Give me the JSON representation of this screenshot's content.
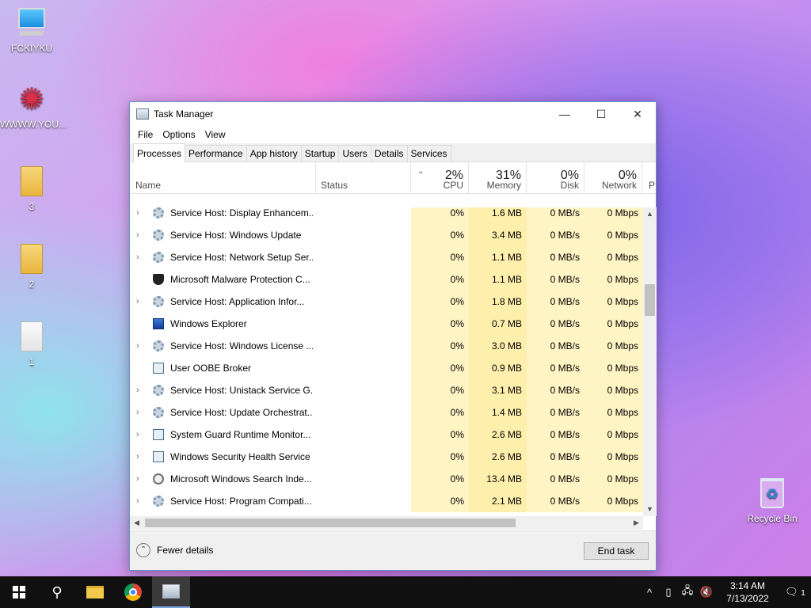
{
  "desktop": {
    "icons": [
      {
        "label": "FCKIYKU",
        "icon": "computer-icon"
      },
      {
        "label": "WWWW.YOU...",
        "icon": "shortcut-icon"
      },
      {
        "label": "3",
        "icon": "folder-icon"
      },
      {
        "label": "2",
        "icon": "folder-icon"
      },
      {
        "label": "1",
        "icon": "document-folder-icon"
      },
      {
        "label": "Recycle Bin",
        "icon": "recycle-bin-icon"
      }
    ]
  },
  "window": {
    "title": "Task Manager",
    "controls": {
      "minimize": "—",
      "maximize": "☐",
      "close": "✕"
    },
    "menu": [
      "File",
      "Options",
      "View"
    ],
    "tabs": [
      "Processes",
      "Performance",
      "App history",
      "Startup",
      "Users",
      "Details",
      "Services"
    ],
    "active_tab": "Processes",
    "columns": {
      "name": "Name",
      "status": "Status",
      "cpu": {
        "pct": "2%",
        "label": "CPU"
      },
      "memory": {
        "pct": "31%",
        "label": "Memory"
      },
      "disk": {
        "pct": "0%",
        "label": "Disk"
      },
      "network": {
        "pct": "0%",
        "label": "Network"
      },
      "power": "P"
    },
    "processes": [
      {
        "name": "Service Host: Display Enhancem...",
        "icon": "gear",
        "expand": true,
        "cpu": "0%",
        "memory": "1.6 MB",
        "disk": "0 MB/s",
        "network": "0 Mbps"
      },
      {
        "name": "Service Host: Windows Update",
        "icon": "gear",
        "expand": true,
        "cpu": "0%",
        "memory": "3.4 MB",
        "disk": "0 MB/s",
        "network": "0 Mbps"
      },
      {
        "name": "Service Host: Network Setup Ser...",
        "icon": "gear",
        "expand": true,
        "cpu": "0%",
        "memory": "1.1 MB",
        "disk": "0 MB/s",
        "network": "0 Mbps"
      },
      {
        "name": "Microsoft Malware Protection C...",
        "icon": "shield",
        "expand": false,
        "cpu": "0%",
        "memory": "1.1 MB",
        "disk": "0 MB/s",
        "network": "0 Mbps"
      },
      {
        "name": "Service Host: Application Infor...",
        "icon": "gear",
        "expand": true,
        "cpu": "0%",
        "memory": "1.8 MB",
        "disk": "0 MB/s",
        "network": "0 Mbps"
      },
      {
        "name": "Windows Explorer",
        "icon": "explorer",
        "expand": false,
        "cpu": "0%",
        "memory": "0.7 MB",
        "disk": "0 MB/s",
        "network": "0 Mbps"
      },
      {
        "name": "Service Host: Windows License ...",
        "icon": "gear",
        "expand": true,
        "cpu": "0%",
        "memory": "3.0 MB",
        "disk": "0 MB/s",
        "network": "0 Mbps"
      },
      {
        "name": "User OOBE Broker",
        "icon": "winbox",
        "expand": false,
        "cpu": "0%",
        "memory": "0.9 MB",
        "disk": "0 MB/s",
        "network": "0 Mbps"
      },
      {
        "name": "Service Host: Unistack Service G...",
        "icon": "gear",
        "expand": true,
        "cpu": "0%",
        "memory": "3.1 MB",
        "disk": "0 MB/s",
        "network": "0 Mbps"
      },
      {
        "name": "Service Host: Update Orchestrat...",
        "icon": "gear",
        "expand": true,
        "cpu": "0%",
        "memory": "1.4 MB",
        "disk": "0 MB/s",
        "network": "0 Mbps"
      },
      {
        "name": "System Guard Runtime Monitor...",
        "icon": "winbox",
        "expand": true,
        "cpu": "0%",
        "memory": "2.6 MB",
        "disk": "0 MB/s",
        "network": "0 Mbps"
      },
      {
        "name": "Windows Security Health Service",
        "icon": "winbox",
        "expand": true,
        "cpu": "0%",
        "memory": "2.6 MB",
        "disk": "0 MB/s",
        "network": "0 Mbps"
      },
      {
        "name": "Microsoft Windows Search Inde...",
        "icon": "search",
        "expand": true,
        "cpu": "0%",
        "memory": "13.4 MB",
        "disk": "0 MB/s",
        "network": "0 Mbps"
      },
      {
        "name": "Service Host: Program Compati...",
        "icon": "gear",
        "expand": true,
        "cpu": "0%",
        "memory": "2.1 MB",
        "disk": "0 MB/s",
        "network": "0 Mbps"
      }
    ],
    "fewer_details": "Fewer details",
    "end_task": "End task"
  },
  "taskbar": {
    "time": "3:14 AM",
    "date": "7/13/2022",
    "notification_count": "1"
  }
}
